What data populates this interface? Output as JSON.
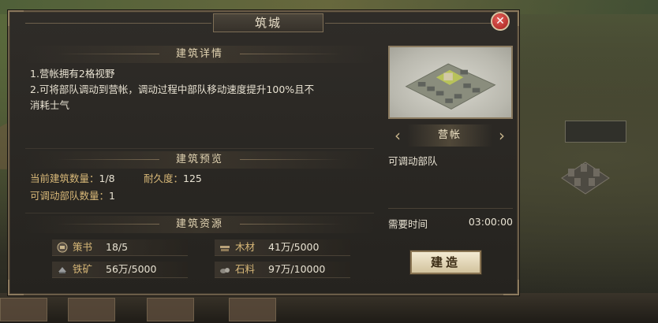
{
  "dialog": {
    "title": "筑城",
    "close_symbol": "✕"
  },
  "details": {
    "header": "建筑详情",
    "lines": [
      "1.营帐拥有2格视野",
      "2.可将部队调动到营帐，调动过程中部队移动速度提升100%且不",
      "消耗士气"
    ]
  },
  "overview": {
    "header": "建筑预览",
    "current_count_label": "当前建筑数量：",
    "current_count_value": "1/8",
    "durability_label": "耐久度：",
    "durability_value": "125",
    "movable_troops_label": "可调动部队数量：",
    "movable_troops_value": "1"
  },
  "resources": {
    "header": "建筑资源",
    "items": [
      {
        "label": "策书",
        "value": "18/5",
        "icon": "scroll-icon"
      },
      {
        "label": "木材",
        "value": "41万/5000",
        "icon": "wood-icon"
      },
      {
        "label": "铁矿",
        "value": "56万/5000",
        "icon": "iron-icon"
      },
      {
        "label": "石料",
        "value": "97万/10000",
        "icon": "stone-icon"
      }
    ]
  },
  "building": {
    "name": "营帐",
    "description": "可调动部队",
    "time_label": "需要时间",
    "time_value": "03:00:00",
    "build_button": "建造",
    "prev_symbol": "‹",
    "next_symbol": "›"
  },
  "colors": {
    "label_gold": "#d8b878",
    "text_light": "#e8e2d2",
    "close_red": "#c4302a"
  }
}
